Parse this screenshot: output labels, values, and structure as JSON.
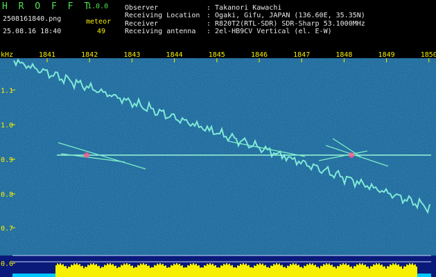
{
  "header": {
    "app_name": "H R O F F T",
    "version": "1.0.0",
    "filename": "2508161840.png",
    "datetime": "25.08.16 18:40",
    "count_label": "meteor",
    "count_value": "49",
    "info": [
      {
        "label": "Observer",
        "value": ": Takanori Kawachi"
      },
      {
        "label": "Receiving Location",
        "value": ": Ogaki, Gifu, JAPAN (136.60E, 35.35N)"
      },
      {
        "label": "Receiver",
        "value": ": R820T2(RTL-SDR) SDR-Sharp 53.1000MHz"
      },
      {
        "label": "Receiving antenna",
        "value": ": 2el-HB9CV Vertical (el. E-W)"
      }
    ]
  },
  "spectrogram": {
    "freq_unit": "kHz",
    "time_ticks": [
      "1841",
      "1842",
      "1843",
      "1844",
      "1845",
      "1846",
      "1847",
      "1848",
      "1849",
      "1850"
    ],
    "freq_ticks": [
      "1.1",
      "1.0",
      "0.9",
      "0.8",
      "0.7",
      "0.6"
    ],
    "colors": {
      "background": "#0a1a7a",
      "trace": "#8fffe0",
      "carrier": "#9cf7d8",
      "level_yellow": "#f6f000",
      "level_cyan": "#00c8ff",
      "axis_text": "#f6f000"
    }
  }
}
